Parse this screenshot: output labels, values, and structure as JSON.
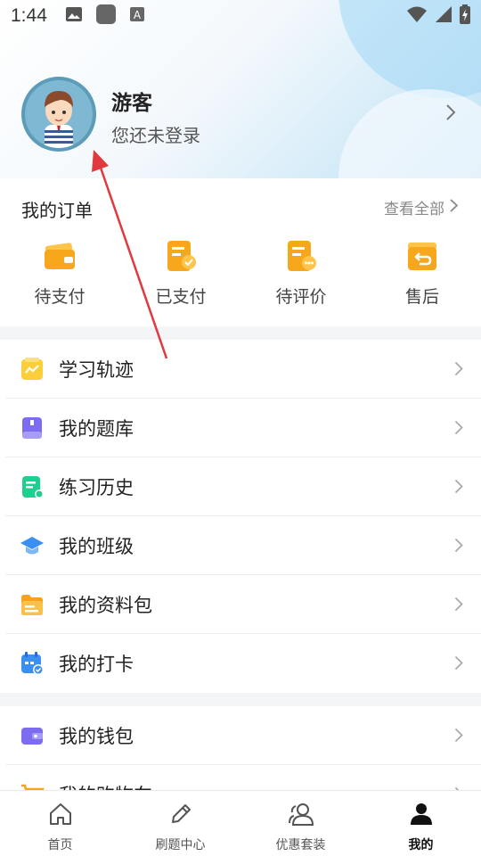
{
  "status_bar": {
    "time": "1:44"
  },
  "profile": {
    "name": "游客",
    "subtitle": "您还未登录"
  },
  "orders": {
    "title": "我的订单",
    "view_all": "查看全部",
    "items": [
      {
        "label": "待支付",
        "icon": "wallet-icon",
        "color": "#f7a71c"
      },
      {
        "label": "已支付",
        "icon": "paid-icon",
        "color": "#f7a71c"
      },
      {
        "label": "待评价",
        "icon": "review-icon",
        "color": "#f7a71c"
      },
      {
        "label": "售后",
        "icon": "after-sales-icon",
        "color": "#f7a71c"
      }
    ]
  },
  "menu_group_1": [
    {
      "label": "学习轨迹",
      "icon": "trend-icon",
      "color": "#fbcf3b"
    },
    {
      "label": "我的题库",
      "icon": "question-bank-icon",
      "color": "#7b6cf0"
    },
    {
      "label": "练习历史",
      "icon": "practice-history-icon",
      "color": "#1fcf8f"
    },
    {
      "label": "我的班级",
      "icon": "graduation-cap-icon",
      "color": "#3b8ff0"
    },
    {
      "label": "我的资料包",
      "icon": "folder-icon",
      "color": "#f7a21c"
    },
    {
      "label": "我的打卡",
      "icon": "calendar-check-icon",
      "color": "#3b8ff0"
    }
  ],
  "menu_group_2": [
    {
      "label": "我的钱包",
      "icon": "wallet-card-icon",
      "color": "#7b6cf0"
    },
    {
      "label": "我的购物车",
      "icon": "cart-icon",
      "color": "#f7a21c"
    }
  ],
  "tabbar": [
    {
      "label": "首页",
      "icon": "home-icon",
      "active": false
    },
    {
      "label": "刷题中心",
      "icon": "pencil-icon",
      "active": false
    },
    {
      "label": "优惠套装",
      "icon": "users-icon",
      "active": false
    },
    {
      "label": "我的",
      "icon": "person-icon",
      "active": true
    }
  ]
}
